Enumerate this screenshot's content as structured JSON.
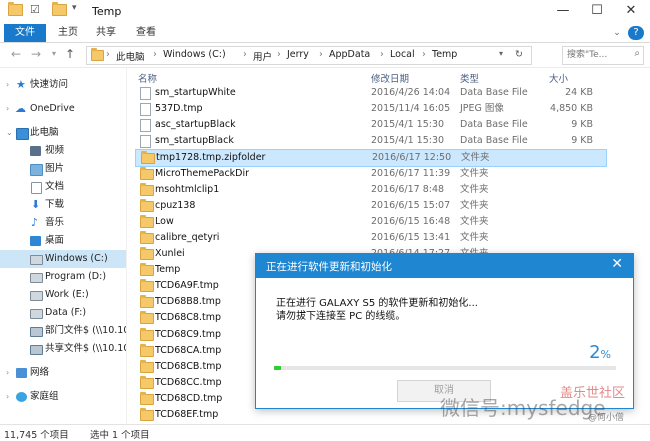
{
  "window": {
    "title": "Temp"
  },
  "ribbon": {
    "tabs": [
      "文件",
      "主页",
      "共享",
      "查看"
    ]
  },
  "address": {
    "crumbs": [
      "此电脑",
      "Windows (C:)",
      "用户",
      "Jerry",
      "AppData",
      "Local",
      "Temp"
    ],
    "search_placeholder": "搜索\"Te..."
  },
  "columns": {
    "name": "名称",
    "date": "修改日期",
    "type": "类型",
    "size": "大小"
  },
  "sidebar": {
    "items": [
      {
        "label": "快速访问",
        "icon": "star-icon"
      },
      {
        "label": "OneDrive",
        "icon": "cloud-icon"
      },
      {
        "label": "此电脑",
        "icon": "computer-icon"
      },
      {
        "label": "视频",
        "icon": "video-icon"
      },
      {
        "label": "图片",
        "icon": "pictures-icon"
      },
      {
        "label": "文档",
        "icon": "documents-icon"
      },
      {
        "label": "下载",
        "icon": "download-icon"
      },
      {
        "label": "音乐",
        "icon": "music-icon"
      },
      {
        "label": "桌面",
        "icon": "desktop-icon"
      },
      {
        "label": "Windows (C:)",
        "icon": "drive-icon"
      },
      {
        "label": "Program (D:)",
        "icon": "drive-icon"
      },
      {
        "label": "Work (E:)",
        "icon": "drive-icon"
      },
      {
        "label": "Data (F:)",
        "icon": "drive-icon"
      },
      {
        "label": "部门文件$ (\\\\10.10",
        "icon": "network-drive-icon"
      },
      {
        "label": "共享文件$ (\\\\10.10",
        "icon": "network-drive-icon"
      },
      {
        "label": "网络",
        "icon": "network-icon"
      },
      {
        "label": "家庭组",
        "icon": "homegroup-icon"
      }
    ]
  },
  "files": [
    {
      "name": "sm_startupWhite",
      "date": "2016/4/26 14:04",
      "type": "Data Base File",
      "size": "24 KB",
      "kind": "doc"
    },
    {
      "name": "537D.tmp",
      "date": "2015/11/4 16:05",
      "type": "JPEG 图像",
      "size": "4,850 KB",
      "kind": "doc"
    },
    {
      "name": "asc_startupBlack",
      "date": "2015/4/1 15:30",
      "type": "Data Base File",
      "size": "9 KB",
      "kind": "doc"
    },
    {
      "name": "sm_startupBlack",
      "date": "2015/4/1 15:30",
      "type": "Data Base File",
      "size": "9 KB",
      "kind": "doc"
    },
    {
      "name": "tmp1728.tmp.zipfolder",
      "date": "2016/6/17 12:50",
      "type": "文件夹",
      "size": "",
      "kind": "folder"
    },
    {
      "name": "MicroThemePackDir",
      "date": "2016/6/17 11:39",
      "type": "文件夹",
      "size": "",
      "kind": "folder"
    },
    {
      "name": "msohtmlclip1",
      "date": "2016/6/17 8:48",
      "type": "文件夹",
      "size": "",
      "kind": "folder"
    },
    {
      "name": "cpuz138",
      "date": "2016/6/15 15:07",
      "type": "文件夹",
      "size": "",
      "kind": "folder"
    },
    {
      "name": "Low",
      "date": "2016/6/15 16:48",
      "type": "文件夹",
      "size": "",
      "kind": "folder"
    },
    {
      "name": "calibre_qetyri",
      "date": "2016/6/15 13:41",
      "type": "文件夹",
      "size": "",
      "kind": "folder"
    },
    {
      "name": "Xunlei",
      "date": "2016/6/14 17:27",
      "type": "文件夹",
      "size": "",
      "kind": "folder"
    },
    {
      "name": "Temp",
      "date": "",
      "type": "",
      "size": "",
      "kind": "folder"
    },
    {
      "name": "TCD6A9F.tmp",
      "date": "",
      "type": "",
      "size": "",
      "kind": "folder"
    },
    {
      "name": "TCD68B8.tmp",
      "date": "",
      "type": "",
      "size": "",
      "kind": "folder"
    },
    {
      "name": "TCD68C8.tmp",
      "date": "",
      "type": "",
      "size": "",
      "kind": "folder"
    },
    {
      "name": "TCD68C9.tmp",
      "date": "",
      "type": "",
      "size": "",
      "kind": "folder"
    },
    {
      "name": "TCD68CA.tmp",
      "date": "",
      "type": "",
      "size": "",
      "kind": "folder"
    },
    {
      "name": "TCD68CB.tmp",
      "date": "",
      "type": "",
      "size": "",
      "kind": "folder"
    },
    {
      "name": "TCD68CC.tmp",
      "date": "",
      "type": "",
      "size": "",
      "kind": "folder"
    },
    {
      "name": "TCD68CD.tmp",
      "date": "",
      "type": "",
      "size": "",
      "kind": "folder"
    },
    {
      "name": "TCD68EF.tmp",
      "date": "",
      "type": "",
      "size": "",
      "kind": "folder"
    }
  ],
  "status": {
    "count": "11,745 个项目",
    "selected": "选中 1 个项目"
  },
  "dialog": {
    "title": "正在进行软件更新和初始化",
    "line1": "正在进行 GALAXY S5 的软件更新和初始化...",
    "line2": "请勿拔下连接至 PC 的线缆。",
    "percent_value": "2",
    "percent_sign": "%",
    "progress": 0.02,
    "cancel_label": "取消"
  },
  "watermark": {
    "text1": "微信号:mysfedge",
    "text2": "盖乐世社区",
    "text3": "@何小僧"
  },
  "colors": {
    "accent": "#1f86d1",
    "file_tab": "#1979ca",
    "progress": "#33cc33",
    "selection": "#cce8ff"
  }
}
